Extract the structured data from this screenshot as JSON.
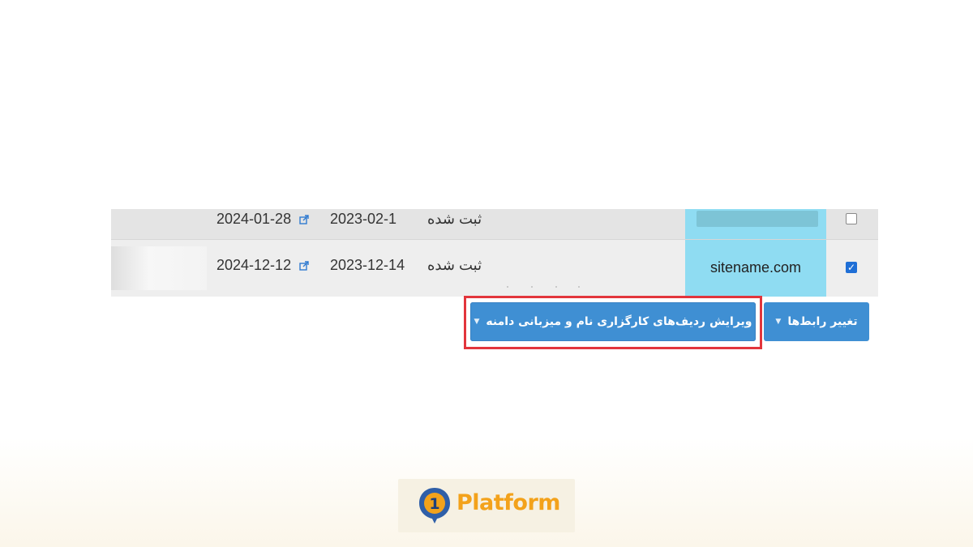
{
  "table": {
    "rows": [
      {
        "domain": "",
        "status": "ثبت شده",
        "registered": "2023-02-1",
        "expires": "2024-01-28",
        "checked": false
      },
      {
        "domain": "sitename.com",
        "status": "ثبت شده",
        "registered": "2023-12-14",
        "expires": "2024-12-12",
        "checked": true
      }
    ]
  },
  "actions": {
    "change_links_label": "تغییر رابط‌ها",
    "edit_dns_label": "ویرایش ردیف‌های کارگزاری نام و میزبانی دامنه"
  },
  "branding": {
    "logo_text": "Platform",
    "logo_mark_digit": "1",
    "brand_color": "#f3a21b",
    "mark_color": "#2f5fa8"
  },
  "colors": {
    "button": "#3f8fd3",
    "highlight": "#e2353c",
    "domain_cell": "#8fdcf2",
    "checkbox_checked": "#1f6fd6"
  },
  "icons": {
    "external_link": "external-link-icon",
    "dropdown_caret": "caret-icon"
  }
}
